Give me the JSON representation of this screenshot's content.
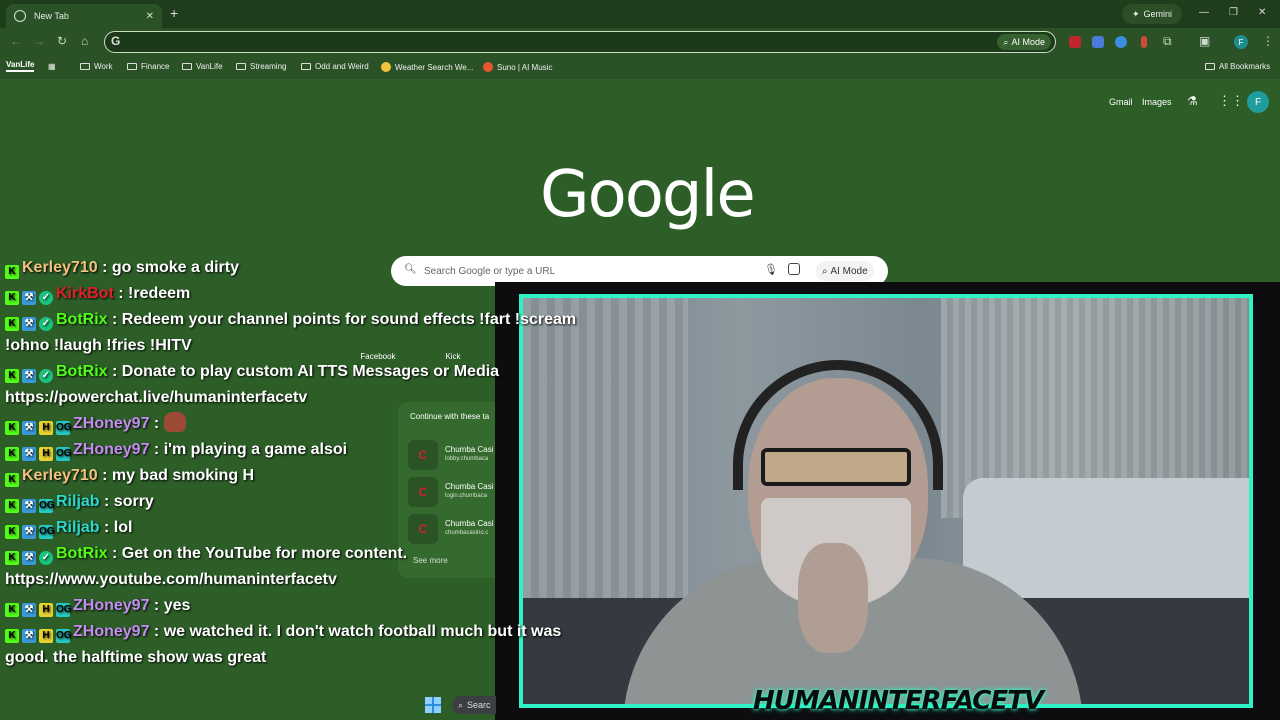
{
  "browser": {
    "tab_title": "New Tab",
    "new_tab": "+",
    "tab_close": "✕",
    "gemini_label": "Gemini",
    "omnibox_prefix": "G",
    "omnibox_value": "",
    "omnibox_ai_mode": "AI Mode",
    "profile_initial": "F"
  },
  "bookmarks": {
    "vanlife_chip": "VanLife",
    "items": [
      {
        "label": "Work",
        "icon": "folder-icon"
      },
      {
        "label": "Finance",
        "icon": "folder-icon"
      },
      {
        "label": "VanLife",
        "icon": "folder-icon"
      },
      {
        "label": "Streaming",
        "icon": "folder-icon"
      },
      {
        "label": "Odd and Weird",
        "icon": "folder-icon"
      },
      {
        "label": "Weather Search We...",
        "icon": "weather-icon"
      },
      {
        "label": "Suno | AI Music",
        "icon": "suno-icon"
      }
    ],
    "all_bookmarks": "All Bookmarks"
  },
  "ntp": {
    "gmail": "Gmail",
    "images": "Images",
    "avatar_initial": "F",
    "logo": "Google",
    "search_placeholder": "Search Google or type a URL",
    "ai_mode": "AI Mode",
    "shortcuts": [
      {
        "label": "Facebook"
      },
      {
        "label": "Kick"
      }
    ],
    "continue": {
      "heading": "Continue with these ta",
      "items": [
        {
          "title": "Chumba Casi",
          "url": "lobby.chumbaca"
        },
        {
          "title": "Chumba Casi",
          "url": "login.chumbaca"
        },
        {
          "title": "Chumba Casi",
          "url": "chumbacasino.c"
        }
      ],
      "see_more": "See more"
    }
  },
  "chat": {
    "messages": [
      {
        "user": "Kerley710",
        "color": "#f1c27d",
        "badges": [
          "kick"
        ],
        "text": ": go smoke a dirty"
      },
      {
        "user": "KirkBot",
        "color": "#e0202a",
        "badges": [
          "kick",
          "mod",
          "verified"
        ],
        "text": ": !redeem"
      },
      {
        "user": "BotRix",
        "color": "#53fc18",
        "badges": [
          "kick",
          "mod",
          "verified"
        ],
        "text": ": Redeem your channel points for sound effects !fart !scream"
      },
      {
        "user": "",
        "color": "#fff",
        "badges": [],
        "text": "!ohno !laugh !fries !HITV"
      },
      {
        "user": "BotRix",
        "color": "#53fc18",
        "badges": [
          "kick",
          "mod",
          "verified"
        ],
        "text": ": Donate to play custom AI TTS Messages or Media"
      },
      {
        "user": "",
        "color": "#fff",
        "badges": [],
        "text": "https://powerchat.live/humaninterfacetv"
      },
      {
        "user": "ZHoney97",
        "color": "#c58cf0",
        "badges": [
          "kick",
          "mod",
          "h",
          "og"
        ],
        "text": ":",
        "emote": true
      },
      {
        "user": "ZHoney97",
        "color": "#c58cf0",
        "badges": [
          "kick",
          "mod",
          "h",
          "og"
        ],
        "text": ": i'm playing a game alsoi"
      },
      {
        "user": "Kerley710",
        "color": "#f1c27d",
        "badges": [
          "kick"
        ],
        "text": ": my bad smoking H"
      },
      {
        "user": "Riljab",
        "color": "#2bd9c9",
        "badges": [
          "kick",
          "mod",
          "og"
        ],
        "text": ": sorry"
      },
      {
        "user": "Riljab",
        "color": "#2bd9c9",
        "badges": [
          "kick",
          "mod",
          "og"
        ],
        "text": ": lol"
      },
      {
        "user": "BotRix",
        "color": "#53fc18",
        "badges": [
          "kick",
          "mod",
          "verified"
        ],
        "text": ": Get on the YouTube for more content."
      },
      {
        "user": "",
        "color": "#fff",
        "badges": [],
        "text": "https://www.youtube.com/humaninterfacetv"
      },
      {
        "user": "ZHoney97",
        "color": "#c58cf0",
        "badges": [
          "kick",
          "mod",
          "h",
          "og"
        ],
        "text": ": yes"
      },
      {
        "user": "ZHoney97",
        "color": "#c58cf0",
        "badges": [
          "kick",
          "mod",
          "h",
          "og"
        ],
        "text": ": we watched it. I don't watch football much but it was"
      },
      {
        "user": "",
        "color": "#fff",
        "badges": [],
        "text": "good. the halftime show was great"
      }
    ]
  },
  "webcam": {
    "brand": "HUMANINTERFACETV",
    "border_color": "#2ff3c4",
    "inner_border_color": "#3a7bff"
  },
  "taskbar": {
    "search_label": "Searc"
  }
}
